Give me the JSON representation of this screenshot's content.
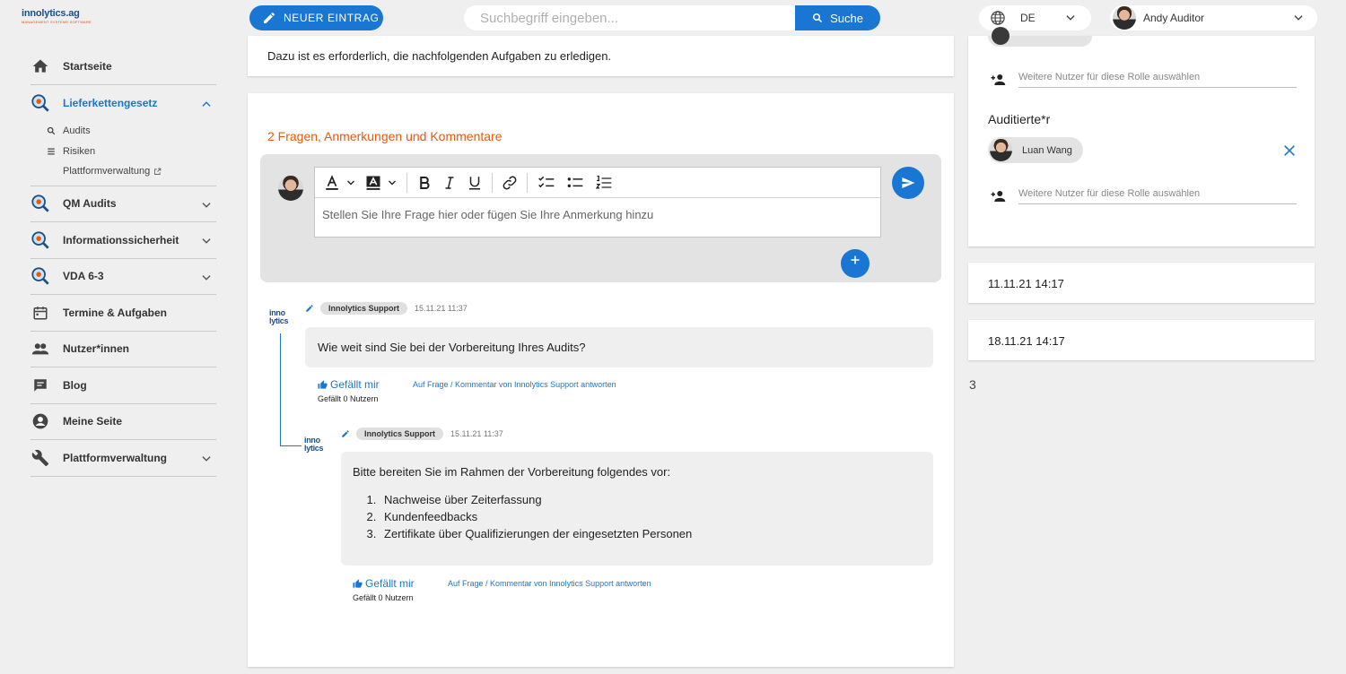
{
  "header": {
    "logo_text": "innolytics.ag",
    "logo_tagline": "MANAGEMENT SYSTEME SOFTWARE",
    "new_entry_label": "NEUER EINTRAG",
    "search_placeholder": "Suchbegriff eingeben...",
    "search_button_label": "Suche",
    "language_code": "DE",
    "user_name": "Andy Auditor"
  },
  "sidebar": {
    "items": [
      {
        "label": "Startseite",
        "icon": "home-icon"
      },
      {
        "label": "Lieferkettengesetz",
        "icon": "magnifier-icon",
        "active": true
      },
      {
        "label": "QM Audits",
        "icon": "magnifier-icon"
      },
      {
        "label": "Informationssicherheit",
        "icon": "magnifier-icon"
      },
      {
        "label": "VDA 6-3",
        "icon": "magnifier-icon"
      },
      {
        "label": "Termine & Aufgaben",
        "icon": "calendar-icon"
      },
      {
        "label": "Nutzer*innen",
        "icon": "people-icon"
      },
      {
        "label": "Blog",
        "icon": "chat-icon"
      },
      {
        "label": "Meine Seite",
        "icon": "account-icon"
      },
      {
        "label": "Plattformverwaltung",
        "icon": "wrench-icon"
      }
    ],
    "subitems": [
      {
        "label": "Audits",
        "icon": "search-icon"
      },
      {
        "label": "Risiken",
        "icon": "list-icon"
      },
      {
        "label": "Plattformverwaltung",
        "icon": "external-link-icon"
      }
    ]
  },
  "main": {
    "intro_text": "Dazu ist es erforderlich, die nachfolgenden Aufgaben zu erledigen.",
    "comments_title": "2 Fragen, Anmerkungen und Kommentare",
    "composer_placeholder": "Stellen Sie Ihre Frage hier oder fügen Sie Ihre Anmerkung hinzu",
    "comments": [
      {
        "author": "Innolytics Support",
        "timestamp": "15.11.21 11:37",
        "text": "Wie weit sind Sie bei der Vorbereitung Ihres Audits?",
        "like_label": "Gefällt mir",
        "likes_text": "Gefällt 0 Nutzern",
        "reply_label": "Auf Frage / Kommentar von Innolytics Support antworten"
      },
      {
        "author": "Innolytics Support",
        "timestamp": "15.11.21 11:37",
        "text": "Bitte bereiten Sie im Rahmen der Vorbereitung folgendes vor:",
        "list": [
          "Nachweise über Zeiterfassung",
          "Kundenfeedbacks",
          "Zertifikate über Qualifizierungen der eingesetzten Personen"
        ],
        "like_label": "Gefällt mir",
        "likes_text": "Gefällt 0 Nutzern",
        "reply_label": "Auf Frage / Kommentar von Innolytics Support antworten"
      }
    ],
    "comment_logo_line1": "inno",
    "comment_logo_line2": "lytics"
  },
  "right": {
    "add_user_placeholder": "Weitere Nutzer für diese Rolle auswählen",
    "role_title": "Auditierte*r",
    "audited_person": "Luan Wang",
    "date_start": "11.11.21 14:17",
    "date_end": "18.11.21 14:17",
    "count": "3"
  },
  "colors": {
    "accent": "#1976d2",
    "highlight": "#e8590c",
    "background": "#efefef"
  }
}
